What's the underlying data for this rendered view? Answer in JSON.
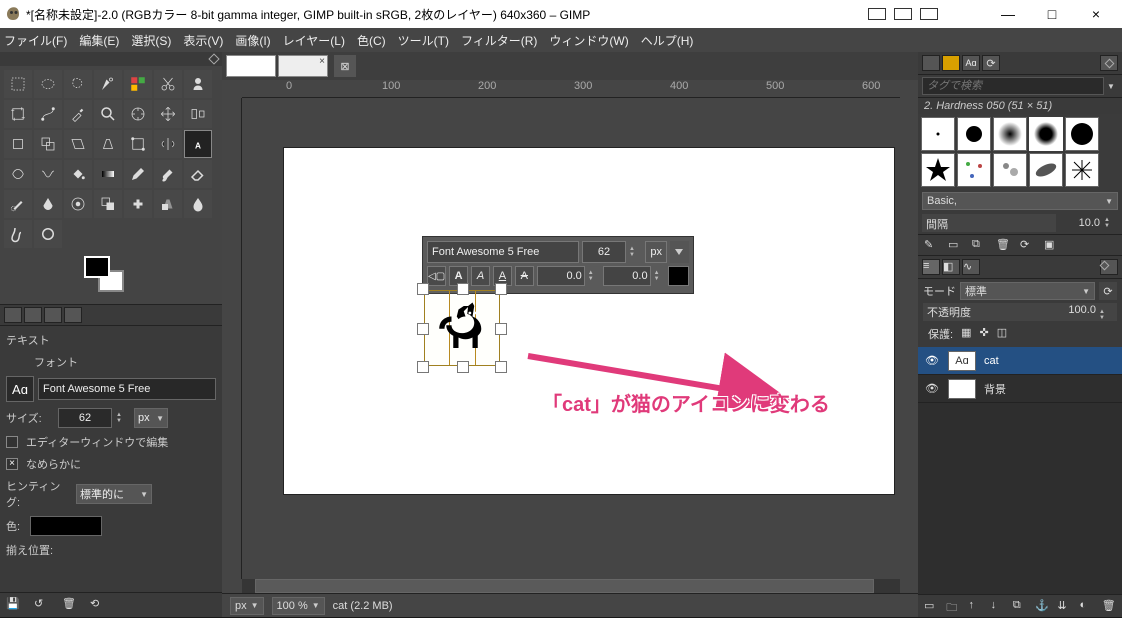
{
  "window": {
    "title": "*[名称未設定]-2.0 (RGBカラー 8-bit gamma integer, GIMP built-in sRGB, 2枚のレイヤー) 640x360 – GIMP",
    "buttons": {
      "min": "—",
      "max": "□",
      "close": "×"
    }
  },
  "menubar": [
    {
      "text": "ファイル(F)",
      "u": "F"
    },
    {
      "text": "編集(E)",
      "u": "E"
    },
    {
      "text": "選択(S)",
      "u": "S"
    },
    {
      "text": "表示(V)",
      "u": "V"
    },
    {
      "text": "画像(I)",
      "u": "I"
    },
    {
      "text": "レイヤー(L)",
      "u": "L"
    },
    {
      "text": "色(C)",
      "u": "C"
    },
    {
      "text": "ツール(T)",
      "u": "T"
    },
    {
      "text": "フィルター(R)",
      "u": "R"
    },
    {
      "text": "ウィンドウ(W)",
      "u": "W"
    },
    {
      "text": "ヘルプ(H)",
      "u": "H"
    }
  ],
  "tool_options": {
    "heading": "テキスト",
    "font_label": "フォント",
    "font_glyph": "Aɑ",
    "font_name": "Font Awesome 5 Free",
    "size_label": "サイズ:",
    "size_value": "62",
    "size_unit": "px",
    "editor_checkbox": "エディターウィンドウで編集",
    "antialias": "なめらかに",
    "hinting_label": "ヒンティング:",
    "hinting_value": "標準的に",
    "color_label": "色:",
    "justify_label": "揃え位置:"
  },
  "text_toolbar": {
    "font": "Font Awesome 5 Free",
    "size": "62",
    "unit": "px",
    "spacing1": "0.0",
    "spacing2": "0.0",
    "a_btns": [
      "A",
      "A",
      "A",
      "A"
    ]
  },
  "annotation": "「cat」が猫のアイコンに変わる",
  "ruler_marks": [
    "0",
    "100",
    "200",
    "300",
    "400",
    "500",
    "600"
  ],
  "statusbar": {
    "unit": "px",
    "zoom": "100 %",
    "status": "cat (2.2 MB)"
  },
  "right": {
    "search_placeholder": "タグで検索",
    "brush_info": "2. Hardness 050 (51 × 51)",
    "preset": "Basic,",
    "spacing_label": "間隔",
    "spacing_value": "10.0",
    "mode_label": "モード",
    "mode_value": "標準",
    "opacity_label": "不透明度",
    "opacity_value": "100.0",
    "lock_label": "保護:",
    "layers": [
      {
        "name": "cat",
        "thumb": "Aɑ",
        "active": true
      },
      {
        "name": "背景",
        "thumb": "",
        "active": false
      }
    ]
  }
}
